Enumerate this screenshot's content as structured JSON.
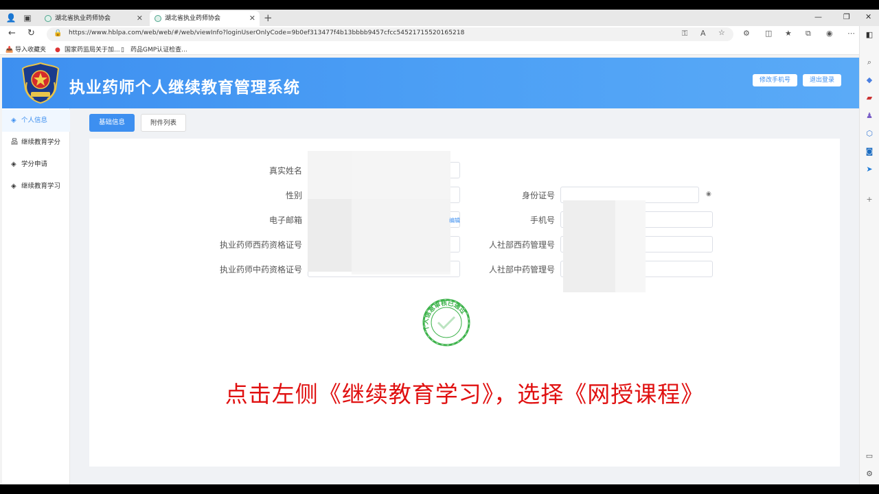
{
  "browser": {
    "tabs": [
      {
        "title": "湖北省执业药师协会"
      },
      {
        "title": "湖北省执业药师协会"
      }
    ],
    "url": "https://www.hblpa.com/web/web/#/web/viewInfo?loginUserOnlyCode=9b0ef313477f4b13bbbb9457cfcc54521715520165218",
    "bookmarks": [
      {
        "label": "导入收藏夹"
      },
      {
        "label": "国家药监局关于加..."
      },
      {
        "label": "药品GMP认证检查..."
      }
    ]
  },
  "header": {
    "title": "执业药师个人继续教育管理系统",
    "change_phone": "修改手机号",
    "logout": "退出登录"
  },
  "sidebar": {
    "items": [
      {
        "label": "个人信息",
        "icon": "layers-icon"
      },
      {
        "label": "继续教育学分",
        "icon": "sitemap-icon"
      },
      {
        "label": "学分申请",
        "icon": "layers-icon"
      },
      {
        "label": "继续教育学习",
        "icon": "layers-icon"
      }
    ]
  },
  "tabs": {
    "basic": "基础信息",
    "attachments": "附件列表"
  },
  "form": {
    "real_name": "真实姓名",
    "gender": "性别",
    "id_number": "身份证号",
    "email": "电子邮箱",
    "email_edit": "编辑",
    "phone": "手机号",
    "western_cert": "执业药师西药资格证号",
    "hr_western": "人社部西药管理号",
    "tcm_cert": "执业药师中药资格证号",
    "hr_tcm": "人社部中药管理号"
  },
  "stamp": {
    "text": "个人信息审核已通过"
  },
  "instruction": "点击左侧《继续教育学习》，选择《网授课程》",
  "colors": {
    "primary": "#3d8ff0",
    "instruction": "#e01010",
    "stamp": "#3cb24a"
  }
}
